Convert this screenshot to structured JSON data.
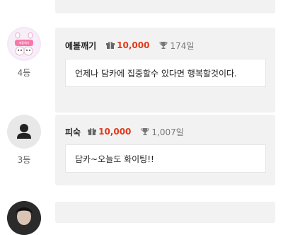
{
  "entries": [
    {
      "rank": "4등",
      "name": "에볼깨기",
      "amount": "10,000",
      "days": "174일",
      "message": "언제나 담카에 집중할수 있다면 행복할것이다.",
      "avatar_text": "에볼깨기",
      "avatar": "cartoon-avatar"
    },
    {
      "rank": "3등",
      "name": "피숙",
      "amount": "10,000",
      "days": "1,007일",
      "message": "담카~오늘도 화이팅!!",
      "avatar": "default-user-icon"
    }
  ],
  "colors": {
    "amount": "#e03a1a",
    "card_bg": "#f2f2f2",
    "avatar_default_bg": "#e8e8e8"
  },
  "icons": [
    "gift-icon",
    "trophy-icon",
    "user-silhouette-icon"
  ]
}
